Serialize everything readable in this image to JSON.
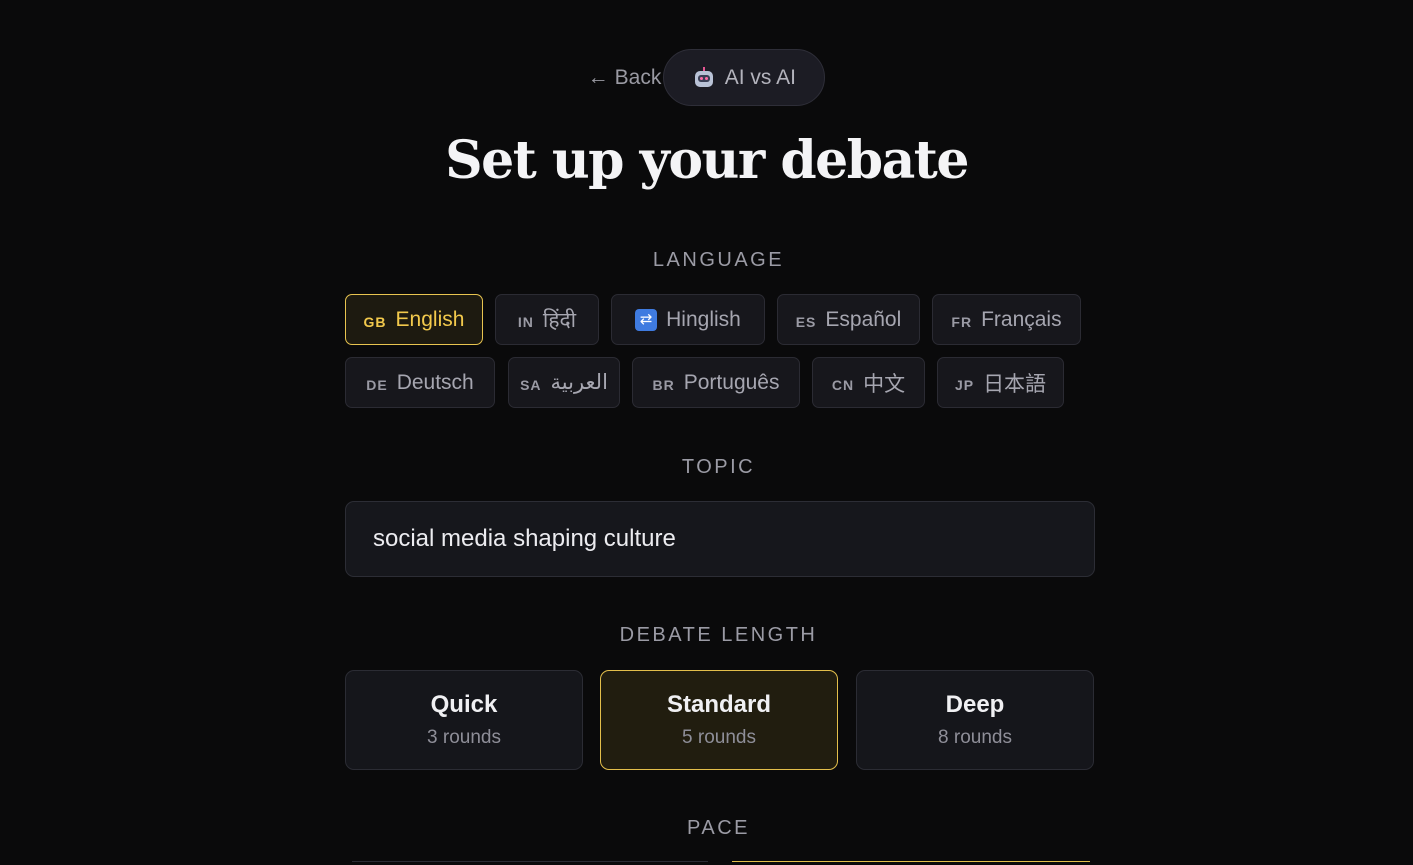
{
  "header": {
    "back_label": "Back",
    "back_arrow": "←",
    "mode_label": "AI vs AI",
    "mode_icon": "robot-icon"
  },
  "title": "Set up your debate",
  "language": {
    "label": "LANGUAGE",
    "options": [
      {
        "code": "GB",
        "label": "English",
        "selected": true
      },
      {
        "code": "IN",
        "label": "हिंदी",
        "selected": false
      },
      {
        "code": "",
        "label": "Hinglish",
        "icon": "shuffle-icon",
        "selected": false
      },
      {
        "code": "ES",
        "label": "Español",
        "selected": false
      },
      {
        "code": "FR",
        "label": "Français",
        "selected": false
      },
      {
        "code": "DE",
        "label": "Deutsch",
        "selected": false
      },
      {
        "code": "SA",
        "label": "العربية",
        "selected": false
      },
      {
        "code": "BR",
        "label": "Português",
        "selected": false
      },
      {
        "code": "CN",
        "label": "中文",
        "selected": false
      },
      {
        "code": "JP",
        "label": "日本語",
        "selected": false
      }
    ]
  },
  "topic": {
    "label": "TOPIC",
    "value": "social media shaping culture"
  },
  "length": {
    "label": "DEBATE LENGTH",
    "options": [
      {
        "name": "Quick",
        "sub": "3 rounds",
        "selected": false
      },
      {
        "name": "Standard",
        "sub": "5 rounds",
        "selected": true
      },
      {
        "name": "Deep",
        "sub": "8 rounds",
        "selected": false
      }
    ]
  },
  "pace": {
    "label": "PACE"
  },
  "colors": {
    "accent": "#f2c94c",
    "background": "#0a0a0b",
    "card": "#15161b"
  }
}
